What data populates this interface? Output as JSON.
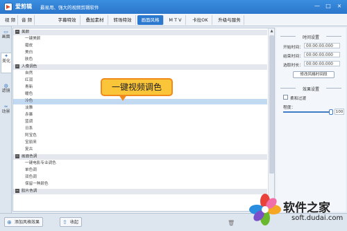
{
  "window": {
    "app_name": "爱剪辑",
    "tagline": "最易用、强大的视频剪辑软件",
    "controls": [
      "—",
      "□",
      "×"
    ]
  },
  "menu": {
    "tabs": [
      {
        "label": "视  频",
        "active": false
      },
      {
        "label": "音  频",
        "active": false
      },
      {
        "label": "字幕特效",
        "active": false
      },
      {
        "label": "叠加素材",
        "active": false
      },
      {
        "label": "转场特效",
        "active": false
      },
      {
        "label": "画面风格",
        "active": true
      },
      {
        "label": "M T V",
        "active": false
      },
      {
        "label": "卡拉OK",
        "active": false
      },
      {
        "label": "升级与服务",
        "active": false
      }
    ]
  },
  "left_tabs": [
    {
      "label": "画面",
      "icon": "frame-icon",
      "active": false
    },
    {
      "label": "美化",
      "icon": "magic-wand-icon",
      "active": true
    },
    {
      "label": "滤镜",
      "icon": "filter-icon",
      "active": false
    },
    {
      "label": "动景",
      "icon": "wave-icon",
      "active": false
    }
  ],
  "style_list": [
    {
      "type": "category",
      "label": "美颜"
    },
    {
      "type": "item",
      "label": "一键美颜"
    },
    {
      "type": "item",
      "label": "磨皮"
    },
    {
      "type": "item",
      "label": "美白"
    },
    {
      "type": "item",
      "label": "肤色"
    },
    {
      "type": "category",
      "label": "人像调色"
    },
    {
      "type": "item",
      "label": "自然"
    },
    {
      "type": "item",
      "label": "红润"
    },
    {
      "type": "item",
      "label": "青新"
    },
    {
      "type": "item",
      "label": "暖色"
    },
    {
      "type": "item",
      "label": "冷色",
      "selected": true
    },
    {
      "type": "item",
      "label": "淡雅"
    },
    {
      "type": "item",
      "label": "赤暴"
    },
    {
      "type": "item",
      "label": "蓝调"
    },
    {
      "type": "item",
      "label": "日系"
    },
    {
      "type": "item",
      "label": "阿宝色"
    },
    {
      "type": "item",
      "label": "宝丽来"
    },
    {
      "type": "item",
      "label": "复古"
    },
    {
      "type": "category",
      "label": "画面色调"
    },
    {
      "type": "item",
      "label": "一键电影专业调色"
    },
    {
      "type": "item",
      "label": "单色调"
    },
    {
      "type": "item",
      "label": "双色调"
    },
    {
      "type": "item",
      "label": "保留一种颜色"
    },
    {
      "type": "category",
      "label": "胶片色调"
    }
  ],
  "callout": {
    "text": "一键视频调色"
  },
  "time_settings": {
    "title": "时间设置",
    "start_label": "开始时间：",
    "start_value": "00:00:00.000",
    "end_label": "结束时间：",
    "end_value": "00:00:00.000",
    "duration_label": "选取时长：",
    "duration_value": "00:00:00.000",
    "modify_button": "修改风格时间段"
  },
  "effect_settings": {
    "title": "效果设置",
    "smooth_label": "柔和过渡",
    "degree_label": "程度：",
    "degree_value": "100",
    "degree_level": 1.0
  },
  "bottom": {
    "add_button": "添加风格效果",
    "collapse_button": "收起"
  },
  "watermark": {
    "text": "软件之家",
    "url": "soft.dudai.com"
  },
  "colors": {
    "title_bar": "#2a76cc",
    "active_tab": "#2b78cf",
    "selected_row": "#c2d9f2",
    "callout_fill": "#fbc53a",
    "callout_border": "#f08a1c"
  }
}
